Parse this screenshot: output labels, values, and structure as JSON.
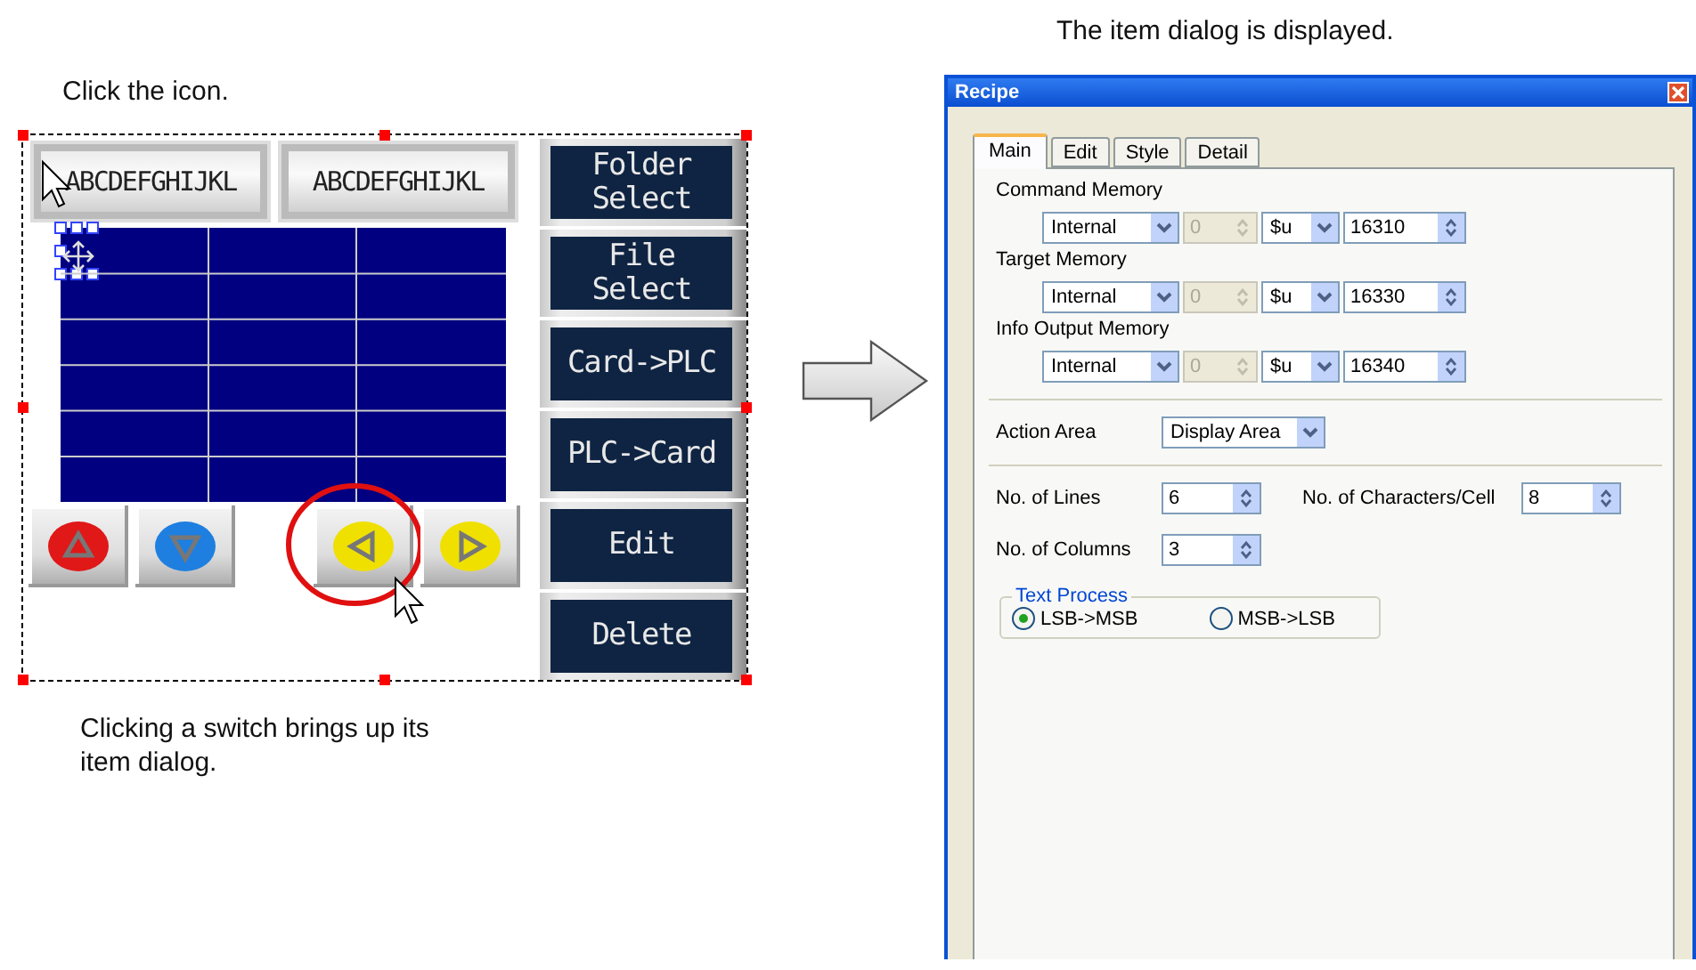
{
  "left_caption": "Click the icon.",
  "hmi_screen": {
    "text_displays": [
      "ABCDEFGHIJKL",
      "ABCDEFGHIJKL"
    ],
    "switches": [
      {
        "kind": "up",
        "color": "#e01818",
        "circled": false
      },
      {
        "kind": "down",
        "color": "#1e7fe0",
        "circled": false
      },
      {
        "kind": "left",
        "color": "#f0e000",
        "circled": true
      },
      {
        "kind": "right",
        "color": "#f0e000",
        "circled": false
      }
    ],
    "side_buttons": [
      "Folder Select",
      "File Select",
      "Card->PLC",
      "PLC->Card",
      "Edit",
      "Delete"
    ]
  },
  "bottom_caption": "Clicking a switch brings up its item dialog.",
  "right_caption": "The item dialog is displayed.",
  "dialog": {
    "title": "Recipe",
    "tabs": [
      {
        "label": "Main",
        "selected": true
      },
      {
        "label": "Edit",
        "selected": false
      },
      {
        "label": "Style",
        "selected": false
      },
      {
        "label": "Detail",
        "selected": false
      }
    ],
    "memories": [
      {
        "label": "Command Memory",
        "device": "Internal",
        "station": "0",
        "station_disabled": true,
        "type": "$u",
        "address": "16310"
      },
      {
        "label": "Target Memory",
        "device": "Internal",
        "station": "0",
        "station_disabled": true,
        "type": "$u",
        "address": "16330"
      },
      {
        "label": "Info Output Memory",
        "device": "Internal",
        "station": "0",
        "station_disabled": true,
        "type": "$u",
        "address": "16340"
      }
    ],
    "action_area": {
      "label": "Action Area",
      "value": "Display Area"
    },
    "no_of_lines": {
      "label": "No. of Lines",
      "value": "6"
    },
    "no_of_characters": {
      "label": "No. of Characters/Cell",
      "value": "8"
    },
    "no_of_columns": {
      "label": "No. of Columns",
      "value": "3"
    },
    "text_process": {
      "legend": "Text Process",
      "options": [
        {
          "label": "LSB->MSB",
          "selected": true
        },
        {
          "label": "MSB->LSB",
          "selected": false
        }
      ]
    }
  }
}
